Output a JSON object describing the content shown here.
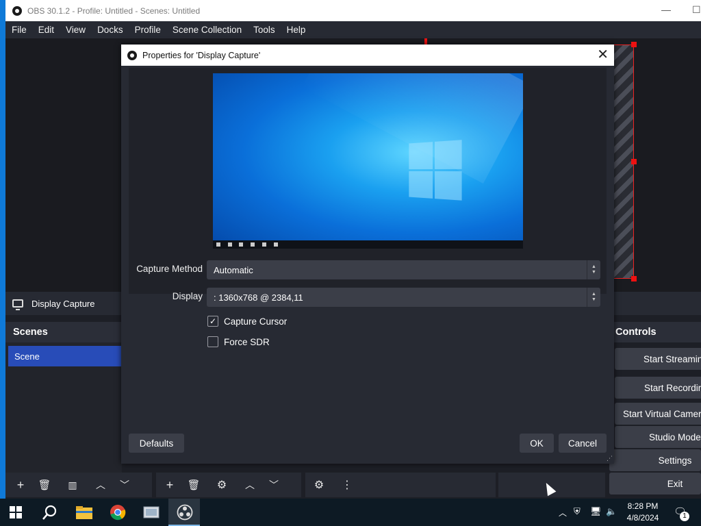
{
  "window": {
    "title": "OBS 30.1.2 - Profile: Untitled - Scenes: Untitled",
    "minimize": "—",
    "maximize": "☐"
  },
  "menu": [
    "File",
    "Edit",
    "View",
    "Docks",
    "Profile",
    "Scene Collection",
    "Tools",
    "Help"
  ],
  "source_bar": {
    "name": "Display Capture"
  },
  "scenes": {
    "title": "Scenes",
    "items": [
      "Scene"
    ]
  },
  "controls": {
    "title": "Controls",
    "buttons": [
      "Start Streaming",
      "Start Recording",
      "Start Virtual Camera",
      "Studio Mode",
      "Settings",
      "Exit"
    ]
  },
  "dialog": {
    "title": "Properties for 'Display Capture'",
    "capture_method_label": "Capture Method",
    "capture_method_value": "Automatic",
    "display_label": "Display",
    "display_value": ": 1360x768 @ 2384,11",
    "capture_cursor_label": "Capture Cursor",
    "capture_cursor_checked": true,
    "force_sdr_label": "Force SDR",
    "force_sdr_checked": false,
    "defaults_label": "Defaults",
    "ok_label": "OK",
    "cancel_label": "Cancel"
  },
  "taskbar": {
    "apps": [
      "start-icon",
      "search-icon",
      "file-explorer-icon",
      "chrome-icon",
      "app-icon",
      "obs-icon"
    ],
    "time": "8:28 PM",
    "date": "4/8/2024",
    "notification_count": "1"
  },
  "colors": {
    "accent": "#284cb8",
    "panel": "#272a33",
    "background": "#1d1f26",
    "selection_border": "#e11111"
  }
}
